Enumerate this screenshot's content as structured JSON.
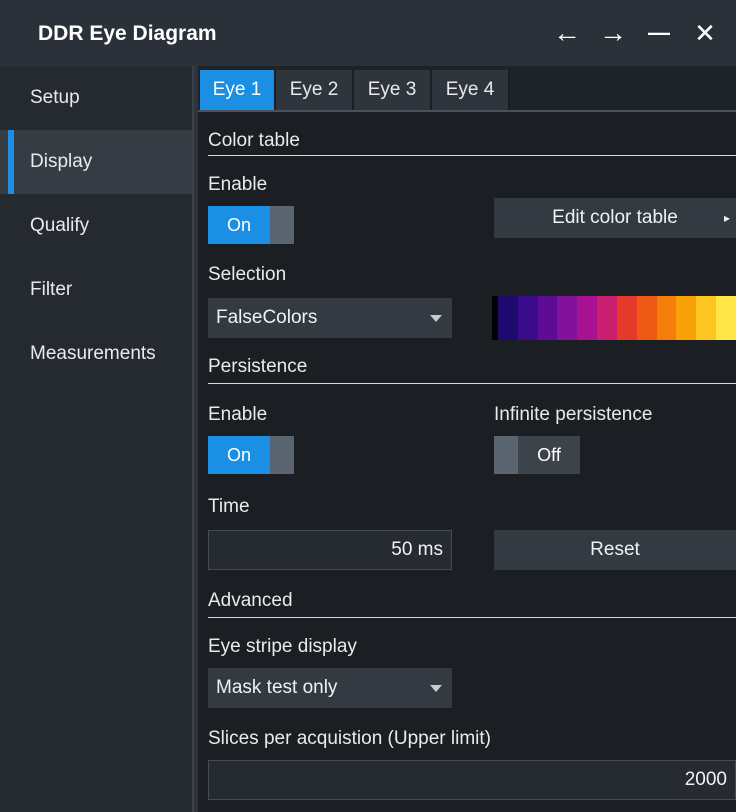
{
  "window": {
    "title": "DDR Eye Diagram"
  },
  "titlebar_buttons": {
    "back": "←",
    "forward": "→",
    "minimize": "—",
    "close": "✕"
  },
  "sidebar": {
    "items": [
      {
        "label": "Setup"
      },
      {
        "label": "Display"
      },
      {
        "label": "Qualify"
      },
      {
        "label": "Filter"
      },
      {
        "label": "Measurements"
      }
    ],
    "active": "Display"
  },
  "tabs": [
    {
      "label": "Eye 1"
    },
    {
      "label": "Eye 2"
    },
    {
      "label": "Eye 3"
    },
    {
      "label": "Eye 4"
    }
  ],
  "active_tab": "Eye 1",
  "color_table": {
    "section_title": "Color table",
    "enable_label": "Enable",
    "enable_state": "On",
    "edit_button": "Edit color table",
    "edit_button_arrow": "▸",
    "selection_label": "Selection",
    "selection_value": "FalseColors",
    "colors": [
      "#1e0a6e",
      "#3a0b8a",
      "#5e0b95",
      "#83129a",
      "#a8118f",
      "#c8206f",
      "#e33a2a",
      "#ee5a14",
      "#f57d0a",
      "#f9a207",
      "#fcc521",
      "#fde646"
    ]
  },
  "persistence": {
    "section_title": "Persistence",
    "enable_label": "Enable",
    "enable_state": "On",
    "infinite_label": "Infinite persistence",
    "infinite_state": "Off",
    "time_label": "Time",
    "time_value": "50 ms",
    "reset_button": "Reset"
  },
  "advanced": {
    "section_title": "Advanced",
    "eye_stripe_label": "Eye stripe display",
    "eye_stripe_value": "Mask test only",
    "slices_label": "Slices per acquistion (Upper limit)",
    "slices_value": "2000"
  },
  "accent_color": "#1a8fe3"
}
